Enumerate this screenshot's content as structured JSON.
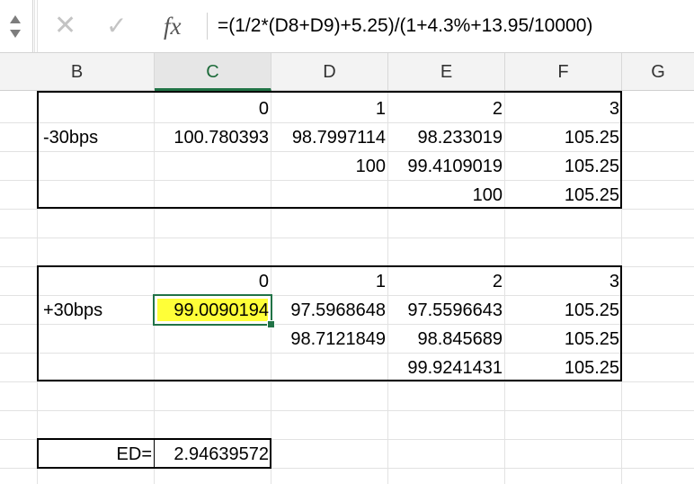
{
  "formula_bar": {
    "icons": [
      "spin-up-icon",
      "spin-down-icon",
      "cancel-icon",
      "enter-icon",
      "function-icon"
    ],
    "cancel_glyph": "✕",
    "enter_glyph": "✓",
    "fx_label": "fx",
    "formula": "=(1/2*(D8+D9)+5.25)/(1+4.3%+13.95/10000)"
  },
  "columns": [
    "B",
    "C",
    "D",
    "E",
    "F",
    "G"
  ],
  "selected_column": "C",
  "table_minus": {
    "header": [
      "0",
      "1",
      "2",
      "3"
    ],
    "label": "-30bps",
    "rows": [
      [
        "100.780393",
        "98.7997114",
        "98.233019",
        "105.25"
      ],
      [
        "",
        "100",
        "99.4109019",
        "105.25"
      ],
      [
        "",
        "",
        "100",
        "105.25"
      ]
    ]
  },
  "table_plus": {
    "header": [
      "0",
      "1",
      "2",
      "3"
    ],
    "label": "+30bps",
    "rows": [
      [
        "99.0090194",
        "97.5968648",
        "97.5596643",
        "105.25"
      ],
      [
        "",
        "98.7121849",
        "98.845689",
        "105.25"
      ],
      [
        "",
        "",
        "99.9241431",
        "105.25"
      ]
    ]
  },
  "ed": {
    "label": "ED=",
    "value": "2.94639572"
  },
  "colors": {
    "selection": "#217346",
    "highlight": "#ffff38"
  }
}
